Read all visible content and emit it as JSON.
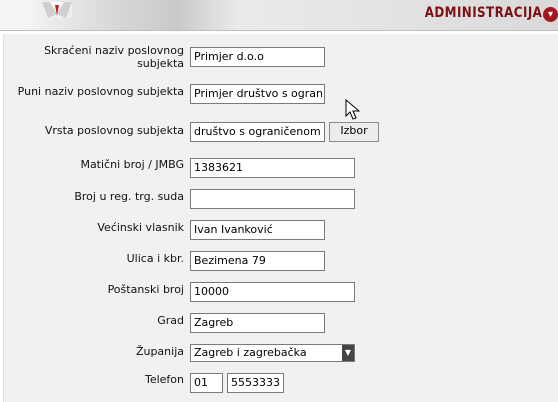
{
  "header": {
    "title": "ADMINISTRACIJA",
    "icon": "down-arrow-icon"
  },
  "form": {
    "skraceni_naziv": {
      "label": "Skraćeni naziv poslovnog subjekta",
      "value": "Primjer d.o.o"
    },
    "puni_naziv": {
      "label": "Puni naziv poslovnog subjekta",
      "value": "Primjer društvo s ograniče"
    },
    "vrsta": {
      "label": "Vrsta poslovnog subjekta",
      "value": "društvo s ograničenom",
      "button": "Izbor"
    },
    "maticni_broj": {
      "label": "Matični broj / JMBG",
      "value": "1383621"
    },
    "broj_reg_suda": {
      "label": "Broj u reg. trg. suda",
      "value": ""
    },
    "vlasnik": {
      "label": "Većinski vlasnik",
      "value": "Ivan Ivanković"
    },
    "ulica": {
      "label": "Ulica i kbr.",
      "value": "Bezimena 79"
    },
    "postanski_broj": {
      "label": "Poštanski broj",
      "value": "10000"
    },
    "grad": {
      "label": "Grad",
      "value": "Zagreb"
    },
    "zupanija": {
      "label": "Županija",
      "value": "Zagreb i zagrebačka"
    },
    "telefon": {
      "label": "Telefon",
      "prefix": "01",
      "number": "5553333"
    }
  }
}
